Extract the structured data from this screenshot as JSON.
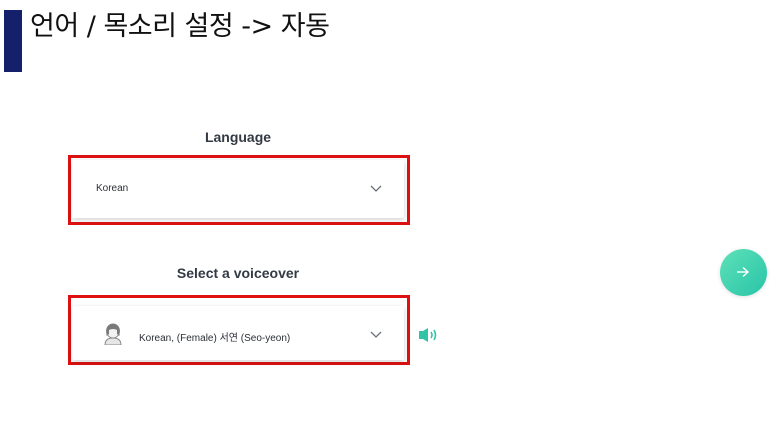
{
  "slide": {
    "title": "언어 / 목소리 설정 -> 자동"
  },
  "language": {
    "label": "Language",
    "selected": "Korean"
  },
  "voiceover": {
    "label": "Select a voiceover",
    "selected": "Korean, (Female) 서연 (Seo-yeon)"
  },
  "icons": {
    "language_chevron": "chevron-down-icon",
    "voice_chevron": "chevron-down-icon",
    "avatar": "female-avatar-icon",
    "speaker": "speaker-icon",
    "next": "arrow-right-icon"
  },
  "colors": {
    "title_bar": "#15206b",
    "highlight": "#dd1111",
    "next_button": "#3fd2ae",
    "speaker": "#2fc4a5"
  }
}
